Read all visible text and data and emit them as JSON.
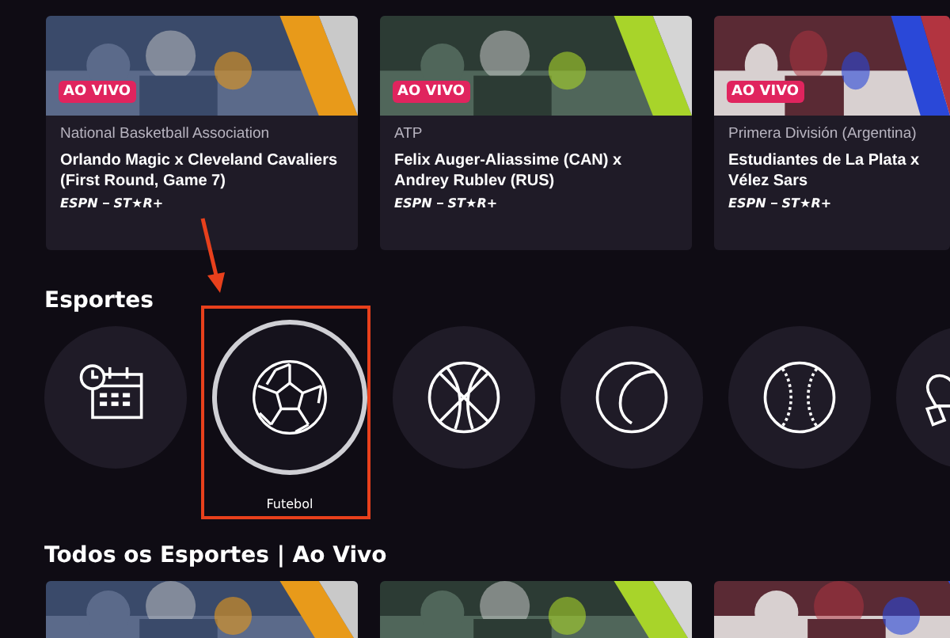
{
  "events": [
    {
      "badge": "AO VIVO",
      "league": "National Basketball Association",
      "title": "Orlando Magic x Cleveland Cavaliers (First Round, Game 7)",
      "providers": [
        "ESPN",
        "ST★R+"
      ],
      "picture": {
        "kind": "picture"
      }
    },
    {
      "badge": "AO VIVO",
      "league": "ATP",
      "title": "Felix Auger-Aliassime (CAN) x Andrey Rublev (RUS)",
      "providers": [
        "ESPN",
        "ST★R+"
      ],
      "picture": {
        "kind": "picture"
      }
    },
    {
      "badge": "AO VIVO",
      "league": "Primera División (Argentina)",
      "title": "Estudiantes de La Plata x Vélez Sars",
      "providers": [
        "ESPN",
        "ST★R+"
      ],
      "picture": {
        "kind": "picture"
      }
    }
  ],
  "sports_section": {
    "title": "Esportes",
    "items": [
      {
        "kind": "calendar",
        "selected": false,
        "highlighted": false
      },
      {
        "kind": "soccer",
        "selected": true,
        "highlighted": true,
        "label": "Futebol"
      },
      {
        "kind": "basketball",
        "selected": false,
        "highlighted": false
      },
      {
        "kind": "tennis",
        "selected": false,
        "highlighted": false
      },
      {
        "kind": "baseball",
        "selected": false,
        "highlighted": false
      },
      {
        "kind": "boxing",
        "selected": false,
        "highlighted": false
      }
    ]
  },
  "live_section": {
    "title": "Todos os Esportes | Ao Vivo",
    "items": [
      {
        "kind": "picture"
      },
      {
        "kind": "picture"
      },
      {
        "kind": "picture"
      }
    ]
  }
}
